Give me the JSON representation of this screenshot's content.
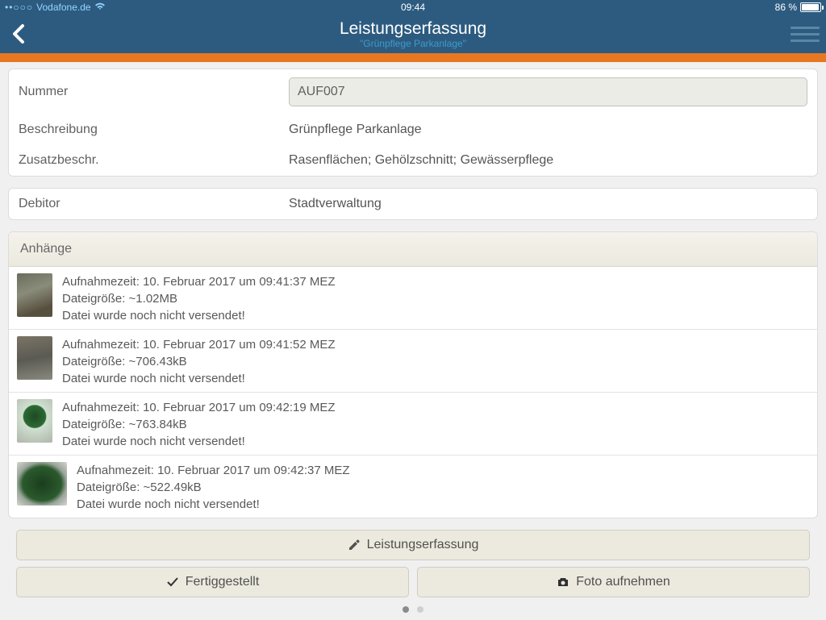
{
  "status": {
    "carrier": "Vodafone.de",
    "time": "09:44",
    "battery": "86 %"
  },
  "header": {
    "title": "Leistungserfassung",
    "subtitle": "\"Grünpflege Parkanlage\""
  },
  "fields": {
    "number_label": "Nummer",
    "number_value": "AUF007",
    "desc_label": "Beschreibung",
    "desc_value": "Grünpflege Parkanlage",
    "extra_label": "Zusatzbeschr.",
    "extra_value": "Rasenflächen; Gehölzschnitt; Gewässerpflege",
    "debitor_label": "Debitor",
    "debitor_value": "Stadtverwaltung"
  },
  "attachments": {
    "header": "Anhänge",
    "prefix_time": "Aufnahmezeit: ",
    "prefix_size": "Dateigröße: ",
    "not_sent": "Datei wurde noch nicht versendet!",
    "items": [
      {
        "time": "10. Februar 2017 um 09:41:37 MEZ",
        "size": "~1.02MB"
      },
      {
        "time": "10. Februar 2017 um 09:41:52 MEZ",
        "size": "~706.43kB"
      },
      {
        "time": "10. Februar 2017 um 09:42:19 MEZ",
        "size": "~763.84kB"
      },
      {
        "time": "10. Februar 2017 um 09:42:37 MEZ",
        "size": "~522.49kB"
      }
    ]
  },
  "buttons": {
    "main": "Leistungserfassung",
    "done": "Fertiggestellt",
    "photo": "Foto aufnehmen"
  }
}
